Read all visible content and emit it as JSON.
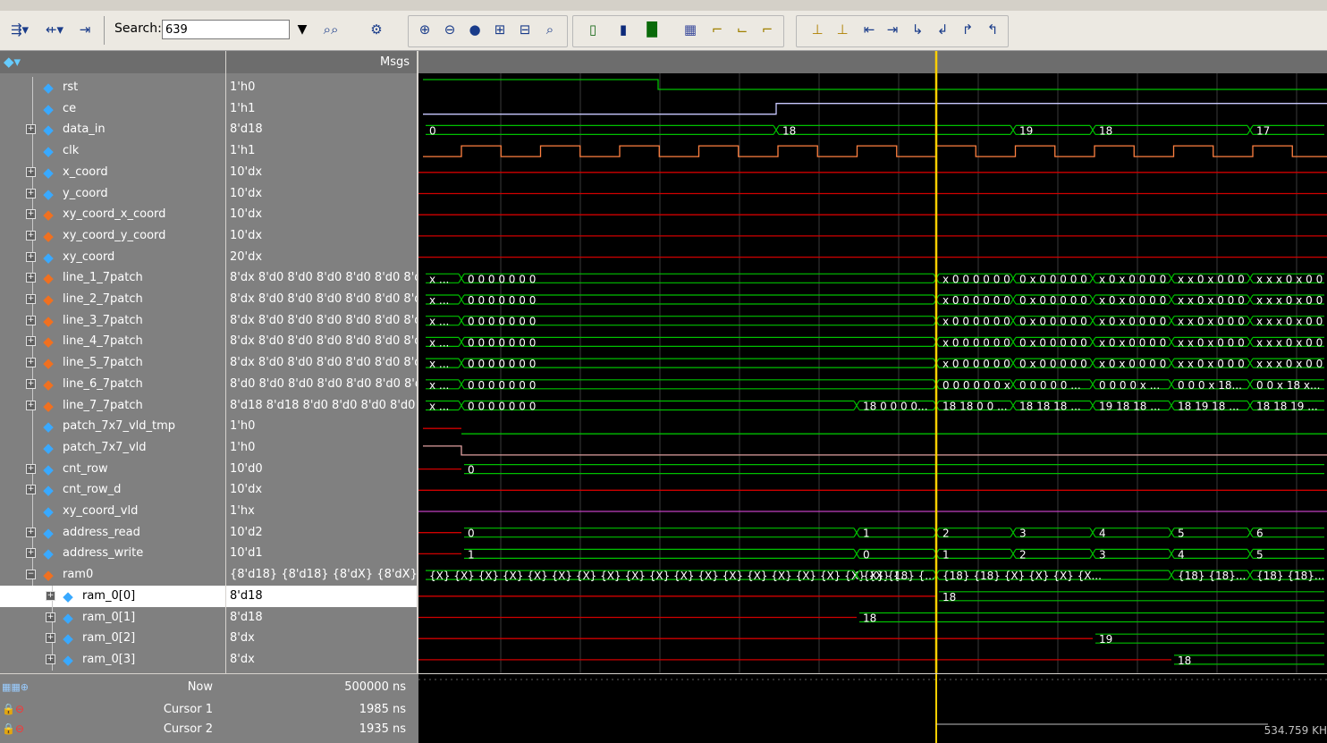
{
  "toolbar": {
    "search_label": "Search:",
    "search_value": "639"
  },
  "columns": {
    "msgs": "Msgs"
  },
  "signals": [
    {
      "name": "rst",
      "value": "1'h0",
      "expand": false,
      "icon": "blue"
    },
    {
      "name": "ce",
      "value": "1'h1",
      "expand": false,
      "icon": "blue"
    },
    {
      "name": "data_in",
      "value": "8'd18",
      "expand": true,
      "icon": "blue"
    },
    {
      "name": "clk",
      "value": "1'h1",
      "expand": false,
      "icon": "blue"
    },
    {
      "name": "x_coord",
      "value": "10'dx",
      "expand": true,
      "icon": "blue-out"
    },
    {
      "name": "y_coord",
      "value": "10'dx",
      "expand": true,
      "icon": "blue-out"
    },
    {
      "name": "xy_coord_x_coord",
      "value": "10'dx",
      "expand": true,
      "icon": "orange"
    },
    {
      "name": "xy_coord_y_coord",
      "value": "10'dx",
      "expand": true,
      "icon": "orange"
    },
    {
      "name": "xy_coord",
      "value": "20'dx",
      "expand": true,
      "icon": "blue-out"
    },
    {
      "name": "line_1_7patch",
      "value": "8'dx 8'd0 8'd0 8'd0 8'd0 8'd0 8'd0",
      "expand": true,
      "icon": "orange"
    },
    {
      "name": "line_2_7patch",
      "value": "8'dx 8'd0 8'd0 8'd0 8'd0 8'd0 8'd0",
      "expand": true,
      "icon": "orange"
    },
    {
      "name": "line_3_7patch",
      "value": "8'dx 8'd0 8'd0 8'd0 8'd0 8'd0 8'd0",
      "expand": true,
      "icon": "orange"
    },
    {
      "name": "line_4_7patch",
      "value": "8'dx 8'd0 8'd0 8'd0 8'd0 8'd0 8'd0",
      "expand": true,
      "icon": "orange"
    },
    {
      "name": "line_5_7patch",
      "value": "8'dx 8'd0 8'd0 8'd0 8'd0 8'd0 8'd0",
      "expand": true,
      "icon": "orange"
    },
    {
      "name": "line_6_7patch",
      "value": "8'd0 8'd0 8'd0 8'd0 8'd0 8'd0 8'dx",
      "expand": true,
      "icon": "orange"
    },
    {
      "name": "line_7_7patch",
      "value": "8'd18 8'd18 8'd0 8'd0 8'd0 8'd0 8...",
      "expand": true,
      "icon": "orange"
    },
    {
      "name": "patch_7x7_vld_tmp",
      "value": "1'h0",
      "expand": false,
      "icon": "blue"
    },
    {
      "name": "patch_7x7_vld",
      "value": "1'h0",
      "expand": false,
      "icon": "blue-out"
    },
    {
      "name": "cnt_row",
      "value": "10'd0",
      "expand": true,
      "icon": "blue"
    },
    {
      "name": "cnt_row_d",
      "value": "10'dx",
      "expand": true,
      "icon": "blue"
    },
    {
      "name": "xy_coord_vld",
      "value": "1'hx",
      "expand": false,
      "icon": "blue-out"
    },
    {
      "name": "address_read",
      "value": "10'd2",
      "expand": true,
      "icon": "blue"
    },
    {
      "name": "address_write",
      "value": "10'd1",
      "expand": true,
      "icon": "blue"
    },
    {
      "name": "ram0",
      "value": "{8'd18} {8'd18} {8'dX} {8'dX} {8...",
      "expand": "open",
      "icon": "orange"
    },
    {
      "name": "ram_0[0]",
      "value": "8'd18",
      "expand": true,
      "icon": "blue",
      "child": true,
      "selected": true
    },
    {
      "name": "ram_0[1]",
      "value": "8'd18",
      "expand": true,
      "icon": "blue",
      "child": true
    },
    {
      "name": "ram_0[2]",
      "value": "8'dx",
      "expand": true,
      "icon": "blue",
      "child": true
    },
    {
      "name": "ram_0[3]",
      "value": "8'dx",
      "expand": true,
      "icon": "blue",
      "child": true
    }
  ],
  "wave_labels": {
    "data_in": [
      "0",
      "18",
      "19",
      "18",
      "17"
    ],
    "line_patch": [
      "x ...",
      "0 0 0 0 0 0 0",
      "x 0 0 0 0 0 0",
      "0 x 0 0 0 0 0",
      "x 0 x 0 0 0 0",
      "x x 0 x 0 0 0",
      "x x x 0 x 0 0"
    ],
    "line_6": [
      "x ...",
      "0 0 0 0 0 0 0",
      "0 0 0 0 0 0 x",
      "0 0 0 0 0 ...",
      "0 0 0 0 x ...",
      "0 0 0 x 18...",
      "0 0 x 18 x..."
    ],
    "line_7": [
      "x ...",
      "0 0 0 0 0 0 0",
      "18 0 0 0 0...",
      "18 18 0 0 ...",
      "18 18 18 ...",
      "19 18 18 ...",
      "18 19 18 ...",
      "18 18 19 ..."
    ],
    "cnt_row": [
      "0"
    ],
    "address_read": [
      "0",
      "1",
      "2",
      "3",
      "4",
      "5",
      "6"
    ],
    "address_write": [
      "1",
      "0",
      "1",
      "2",
      "3",
      "4",
      "5"
    ],
    "ram0": [
      "{X} {X} {X} {X} {X} {X} {X} {X} {X} {X} {X} {X} {X} {X} {X} {X} {X} {X} {X} {...",
      "{X} {18} {...",
      "{18} {18} {X} {X} {X} {X...",
      "{18} {18}...",
      "{18} {18}...",
      "{18} {18}..."
    ],
    "ram_0_0": [
      "18"
    ],
    "ram_0_1": [
      "18"
    ],
    "ram_0_2": [
      "19"
    ],
    "ram_0_3": [
      "18"
    ]
  },
  "status": {
    "now_label": "Now",
    "now_value": "500000 ns",
    "cursor1_label": "Cursor 1",
    "cursor1_value": "1985 ns",
    "cursor2_label": "Cursor 2",
    "cursor2_value": "1935 ns",
    "cursor_delta": "534.759 KH"
  },
  "colors": {
    "wave_green": "#00c000",
    "wave_red": "#d00000",
    "cursor": "#ffd000",
    "clk": "#ff8040",
    "ce": "#c8c8ff"
  }
}
